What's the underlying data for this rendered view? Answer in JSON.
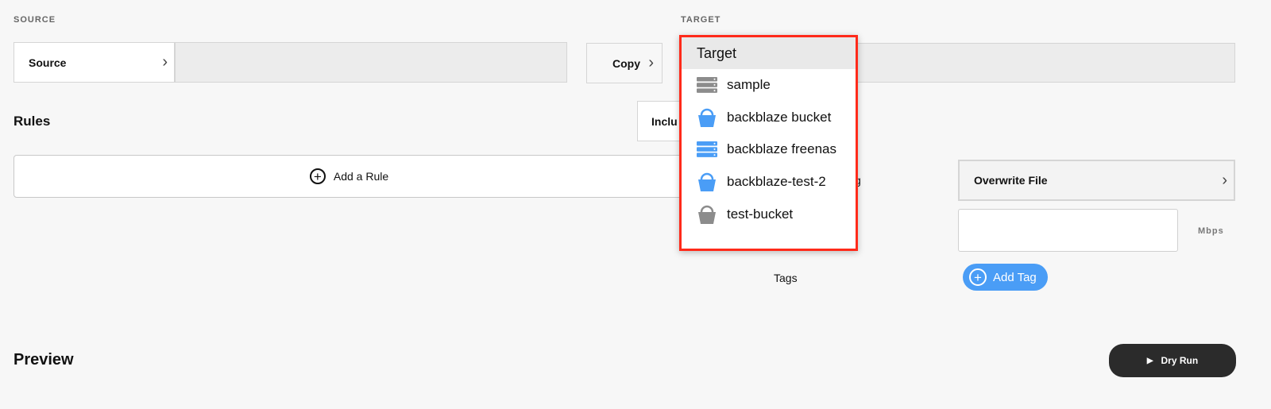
{
  "source": {
    "section_label": "SOURCE",
    "selector_label": "Source"
  },
  "target": {
    "section_label": "TARGET"
  },
  "copy": {
    "label": "Copy"
  },
  "rules": {
    "title": "Rules",
    "add_rule_label": "Add a Rule",
    "include_label_partial": "Inclu"
  },
  "options": {
    "hidden_label_partial": "g",
    "hidden_label_partial_2": ":",
    "overwrite_label": "Overwrite File",
    "bandwidth_unit": "Mbps",
    "bandwidth_value": "",
    "tags_label": "Tags",
    "add_tag_label": "Add Tag"
  },
  "preview": {
    "title": "Preview",
    "dry_run_label": "Dry Run"
  },
  "dropdown": {
    "header": "Target",
    "items": [
      {
        "label": "sample",
        "icon": "server-icon",
        "color": "#8c8c8c"
      },
      {
        "label": "backblaze bucket",
        "icon": "bucket-icon",
        "color": "#4a9df6"
      },
      {
        "label": "backblaze freenas",
        "icon": "server-icon",
        "color": "#4a9df6"
      },
      {
        "label": "backblaze-test-2",
        "icon": "bucket-icon",
        "color": "#4a9df6"
      },
      {
        "label": "test-bucket",
        "icon": "bucket-icon",
        "color": "#8c8c8c"
      }
    ]
  },
  "colors": {
    "highlight_border": "#ff2a1a",
    "accent_blue": "#4a9df6",
    "dark_button": "#2b2b2b"
  }
}
